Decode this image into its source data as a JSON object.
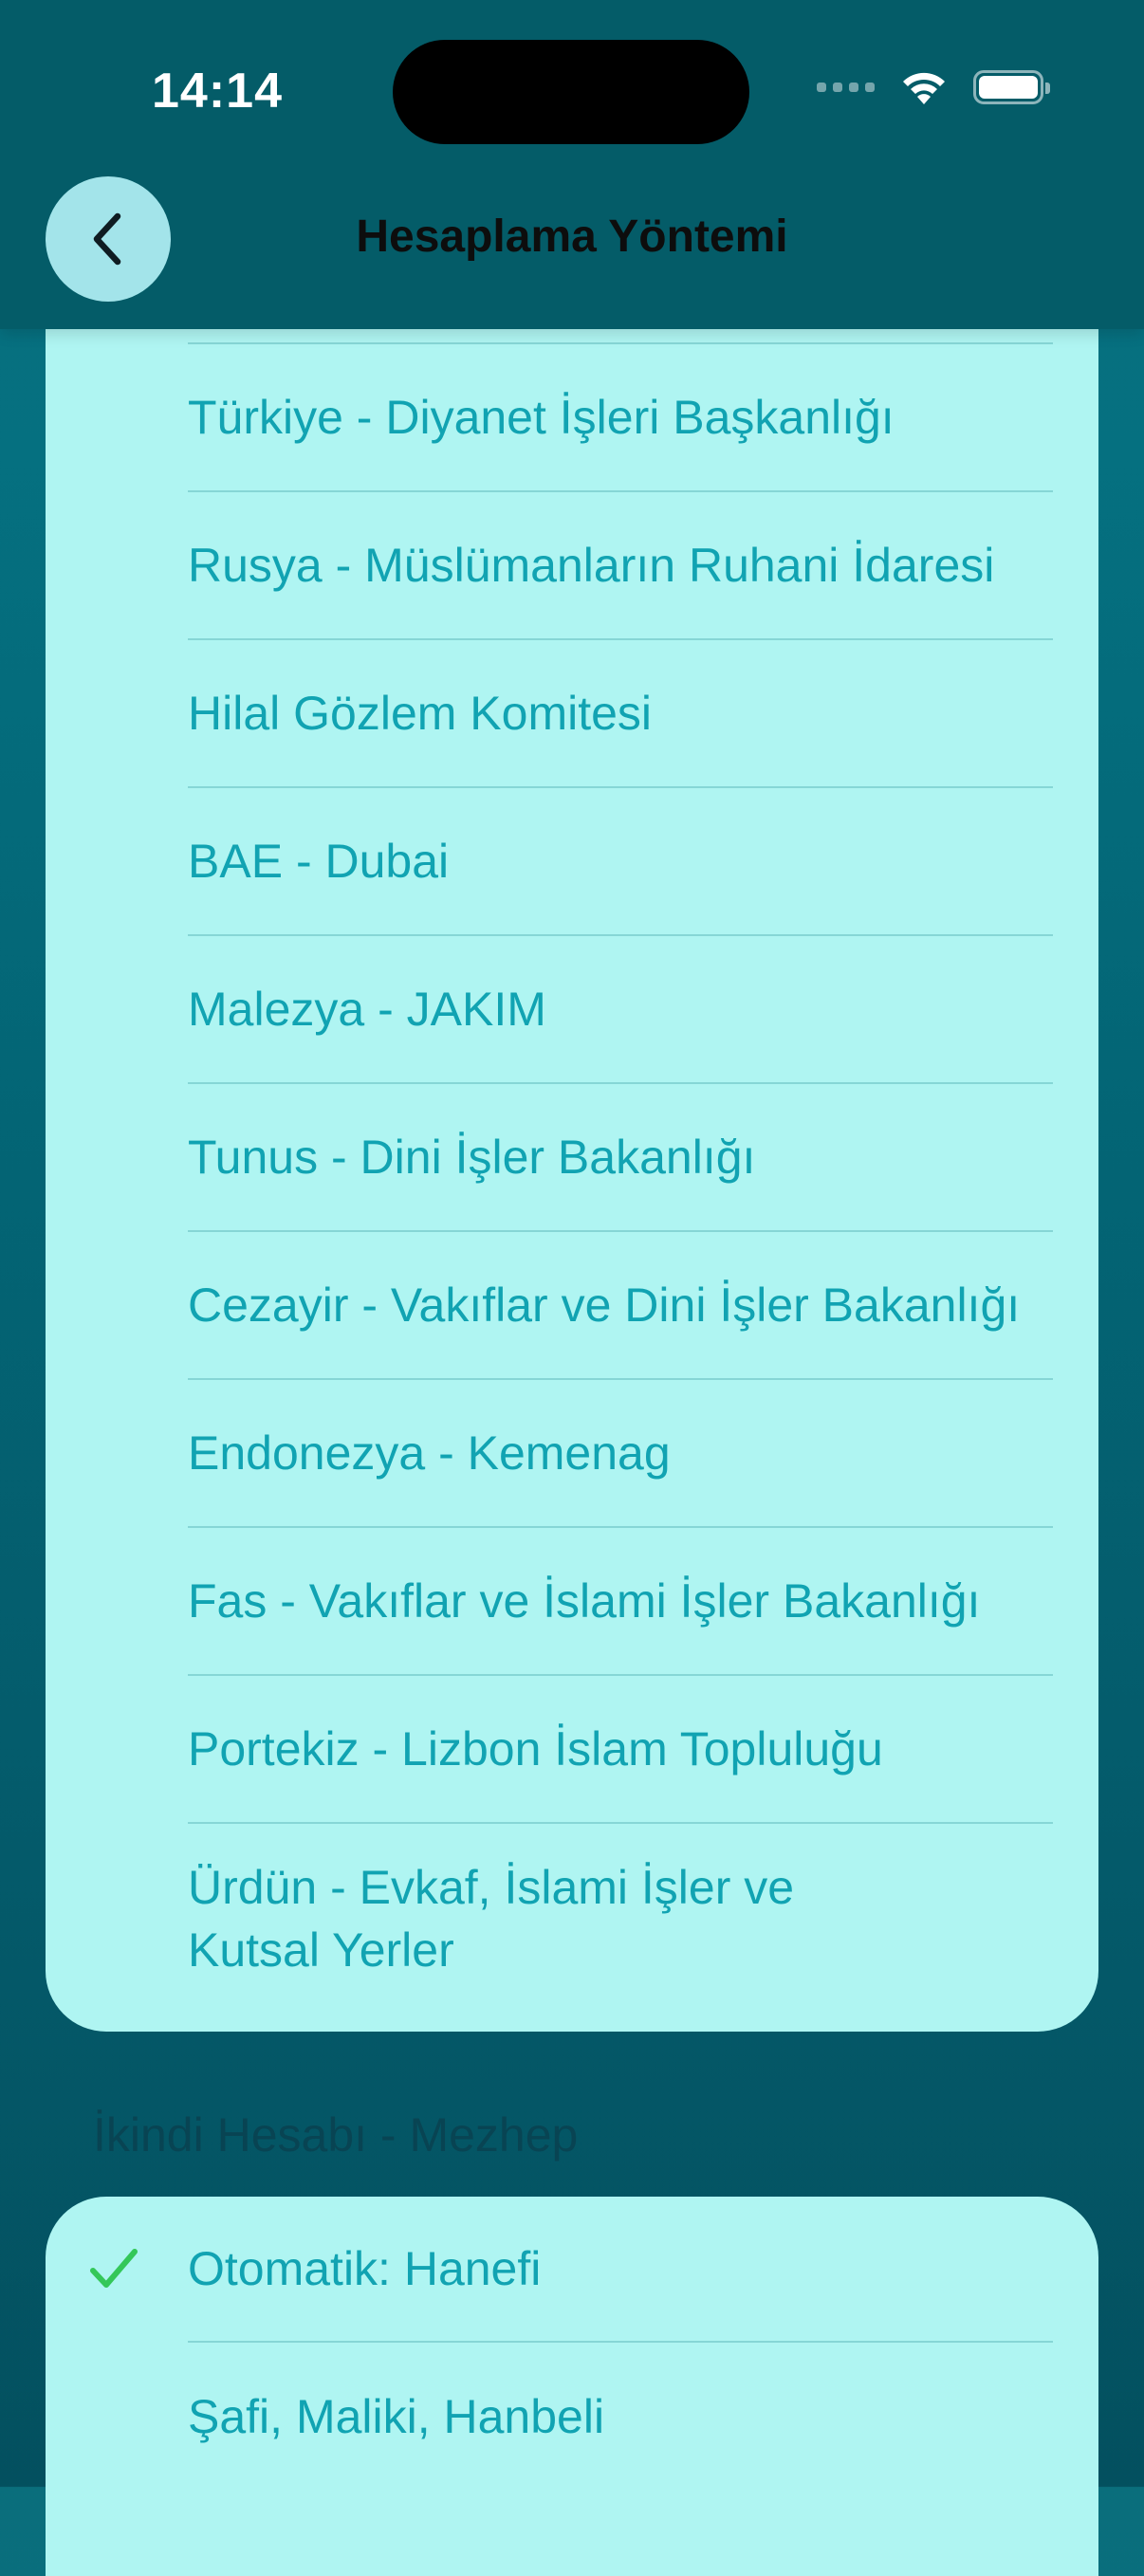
{
  "status_bar": {
    "time": "14:14"
  },
  "nav": {
    "title": "Hesaplama Yöntemi",
    "back_icon": "chevron-left-icon"
  },
  "methods": [
    {
      "label": "Türkiye - Diyanet İşleri Başkanlığı"
    },
    {
      "label": "Rusya - Müslümanların Ruhani İdaresi"
    },
    {
      "label": "Hilal Gözlem Komitesi"
    },
    {
      "label": "BAE - Dubai"
    },
    {
      "label": "Malezya - JAKIM"
    },
    {
      "label": "Tunus - Dini İşler Bakanlığı"
    },
    {
      "label": "Cezayir - Vakıflar ve Dini İşler Bakanlığı"
    },
    {
      "label": "Endonezya - Kemenag"
    },
    {
      "label": "Fas - Vakıflar ve İslami İşler Bakanlığı"
    },
    {
      "label": "Portekiz - Lizbon İslam Topluluğu"
    },
    {
      "label": "Ürdün - Evkaf, İslami İşler ve Kutsal Yerler"
    }
  ],
  "asr_section": {
    "header": "İkindi Hesabı - Mezhep",
    "options": [
      {
        "label": "Otomatik: Hanefi",
        "selected": true
      },
      {
        "label": "Şafi, Maliki, Hanbeli",
        "selected": false
      }
    ]
  },
  "colors": {
    "accent_text": "#11a3b2",
    "card_background": "#aff5f2",
    "check_color": "#34c759",
    "nav_background": "#045c68"
  }
}
